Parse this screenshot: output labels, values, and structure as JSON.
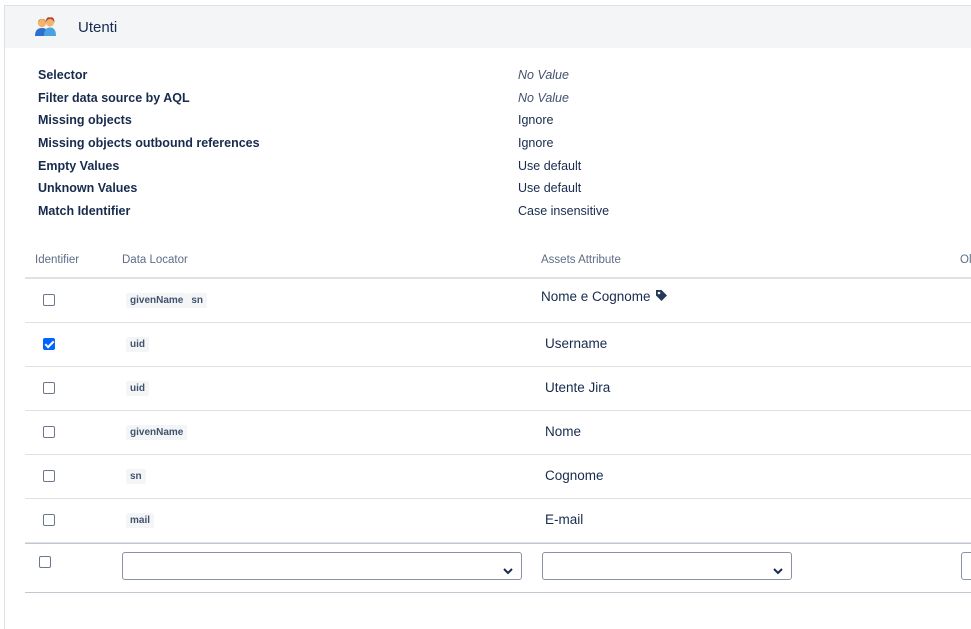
{
  "header": {
    "title": "Utenti",
    "icon": "users-icon"
  },
  "properties": [
    {
      "label": "Selector",
      "value": "No Value",
      "italic": true
    },
    {
      "label": "Filter data source by AQL",
      "value": "No Value",
      "italic": true
    },
    {
      "label": "Missing objects",
      "value": "Ignore",
      "italic": false
    },
    {
      "label": "Missing objects outbound references",
      "value": "Ignore",
      "italic": false
    },
    {
      "label": "Empty Values",
      "value": "Use default",
      "italic": false
    },
    {
      "label": "Unknown Values",
      "value": "Use default",
      "italic": false
    },
    {
      "label": "Match Identifier",
      "value": "Case insensitive",
      "italic": false
    }
  ],
  "table": {
    "columns": {
      "identifier": "Identifier",
      "data_locator": "Data Locator",
      "assets_attribute": "Assets Attribute",
      "partial": "Ol"
    },
    "rows": [
      {
        "checked": false,
        "locators": [
          "givenName",
          "sn"
        ],
        "attribute": "Nome e Cognome",
        "tag": true
      },
      {
        "checked": true,
        "locators": [
          "uid"
        ],
        "attribute": "Username",
        "tag": false
      },
      {
        "checked": false,
        "locators": [
          "uid"
        ],
        "attribute": "Utente Jira",
        "tag": false
      },
      {
        "checked": false,
        "locators": [
          "givenName"
        ],
        "attribute": "Nome",
        "tag": false
      },
      {
        "checked": false,
        "locators": [
          "sn"
        ],
        "attribute": "Cognome",
        "tag": false
      },
      {
        "checked": false,
        "locators": [
          "mail"
        ],
        "attribute": "E-mail",
        "tag": false
      }
    ],
    "new_row": {
      "checked": false,
      "data_locator_value": "",
      "assets_attribute_value": ""
    }
  },
  "colors": {
    "accent": "#0065ff",
    "header_bg": "#f4f5f7",
    "text": "#172b4d"
  }
}
